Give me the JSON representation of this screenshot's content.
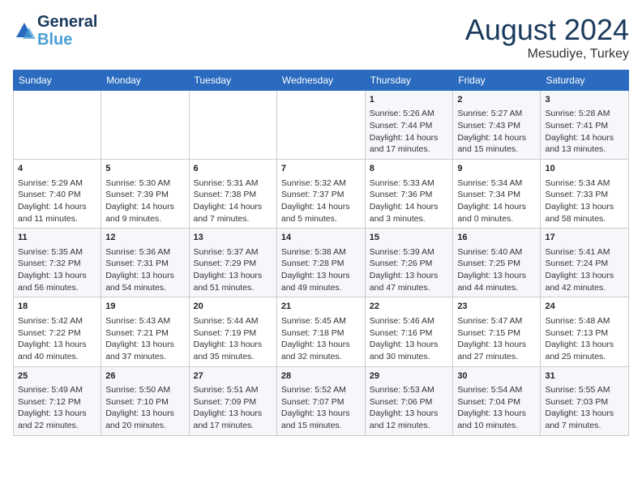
{
  "header": {
    "logo_line1": "General",
    "logo_line2": "Blue",
    "title": "August 2024",
    "subtitle": "Mesudiye, Turkey"
  },
  "calendar": {
    "days_of_week": [
      "Sunday",
      "Monday",
      "Tuesday",
      "Wednesday",
      "Thursday",
      "Friday",
      "Saturday"
    ],
    "weeks": [
      [
        {
          "day": "",
          "content": ""
        },
        {
          "day": "",
          "content": ""
        },
        {
          "day": "",
          "content": ""
        },
        {
          "day": "",
          "content": ""
        },
        {
          "day": "1",
          "content": "Sunrise: 5:26 AM\nSunset: 7:44 PM\nDaylight: 14 hours\nand 17 minutes."
        },
        {
          "day": "2",
          "content": "Sunrise: 5:27 AM\nSunset: 7:43 PM\nDaylight: 14 hours\nand 15 minutes."
        },
        {
          "day": "3",
          "content": "Sunrise: 5:28 AM\nSunset: 7:41 PM\nDaylight: 14 hours\nand 13 minutes."
        }
      ],
      [
        {
          "day": "4",
          "content": "Sunrise: 5:29 AM\nSunset: 7:40 PM\nDaylight: 14 hours\nand 11 minutes."
        },
        {
          "day": "5",
          "content": "Sunrise: 5:30 AM\nSunset: 7:39 PM\nDaylight: 14 hours\nand 9 minutes."
        },
        {
          "day": "6",
          "content": "Sunrise: 5:31 AM\nSunset: 7:38 PM\nDaylight: 14 hours\nand 7 minutes."
        },
        {
          "day": "7",
          "content": "Sunrise: 5:32 AM\nSunset: 7:37 PM\nDaylight: 14 hours\nand 5 minutes."
        },
        {
          "day": "8",
          "content": "Sunrise: 5:33 AM\nSunset: 7:36 PM\nDaylight: 14 hours\nand 3 minutes."
        },
        {
          "day": "9",
          "content": "Sunrise: 5:34 AM\nSunset: 7:34 PM\nDaylight: 14 hours\nand 0 minutes."
        },
        {
          "day": "10",
          "content": "Sunrise: 5:34 AM\nSunset: 7:33 PM\nDaylight: 13 hours\nand 58 minutes."
        }
      ],
      [
        {
          "day": "11",
          "content": "Sunrise: 5:35 AM\nSunset: 7:32 PM\nDaylight: 13 hours\nand 56 minutes."
        },
        {
          "day": "12",
          "content": "Sunrise: 5:36 AM\nSunset: 7:31 PM\nDaylight: 13 hours\nand 54 minutes."
        },
        {
          "day": "13",
          "content": "Sunrise: 5:37 AM\nSunset: 7:29 PM\nDaylight: 13 hours\nand 51 minutes."
        },
        {
          "day": "14",
          "content": "Sunrise: 5:38 AM\nSunset: 7:28 PM\nDaylight: 13 hours\nand 49 minutes."
        },
        {
          "day": "15",
          "content": "Sunrise: 5:39 AM\nSunset: 7:26 PM\nDaylight: 13 hours\nand 47 minutes."
        },
        {
          "day": "16",
          "content": "Sunrise: 5:40 AM\nSunset: 7:25 PM\nDaylight: 13 hours\nand 44 minutes."
        },
        {
          "day": "17",
          "content": "Sunrise: 5:41 AM\nSunset: 7:24 PM\nDaylight: 13 hours\nand 42 minutes."
        }
      ],
      [
        {
          "day": "18",
          "content": "Sunrise: 5:42 AM\nSunset: 7:22 PM\nDaylight: 13 hours\nand 40 minutes."
        },
        {
          "day": "19",
          "content": "Sunrise: 5:43 AM\nSunset: 7:21 PM\nDaylight: 13 hours\nand 37 minutes."
        },
        {
          "day": "20",
          "content": "Sunrise: 5:44 AM\nSunset: 7:19 PM\nDaylight: 13 hours\nand 35 minutes."
        },
        {
          "day": "21",
          "content": "Sunrise: 5:45 AM\nSunset: 7:18 PM\nDaylight: 13 hours\nand 32 minutes."
        },
        {
          "day": "22",
          "content": "Sunrise: 5:46 AM\nSunset: 7:16 PM\nDaylight: 13 hours\nand 30 minutes."
        },
        {
          "day": "23",
          "content": "Sunrise: 5:47 AM\nSunset: 7:15 PM\nDaylight: 13 hours\nand 27 minutes."
        },
        {
          "day": "24",
          "content": "Sunrise: 5:48 AM\nSunset: 7:13 PM\nDaylight: 13 hours\nand 25 minutes."
        }
      ],
      [
        {
          "day": "25",
          "content": "Sunrise: 5:49 AM\nSunset: 7:12 PM\nDaylight: 13 hours\nand 22 minutes."
        },
        {
          "day": "26",
          "content": "Sunrise: 5:50 AM\nSunset: 7:10 PM\nDaylight: 13 hours\nand 20 minutes."
        },
        {
          "day": "27",
          "content": "Sunrise: 5:51 AM\nSunset: 7:09 PM\nDaylight: 13 hours\nand 17 minutes."
        },
        {
          "day": "28",
          "content": "Sunrise: 5:52 AM\nSunset: 7:07 PM\nDaylight: 13 hours\nand 15 minutes."
        },
        {
          "day": "29",
          "content": "Sunrise: 5:53 AM\nSunset: 7:06 PM\nDaylight: 13 hours\nand 12 minutes."
        },
        {
          "day": "30",
          "content": "Sunrise: 5:54 AM\nSunset: 7:04 PM\nDaylight: 13 hours\nand 10 minutes."
        },
        {
          "day": "31",
          "content": "Sunrise: 5:55 AM\nSunset: 7:03 PM\nDaylight: 13 hours\nand 7 minutes."
        }
      ]
    ]
  }
}
